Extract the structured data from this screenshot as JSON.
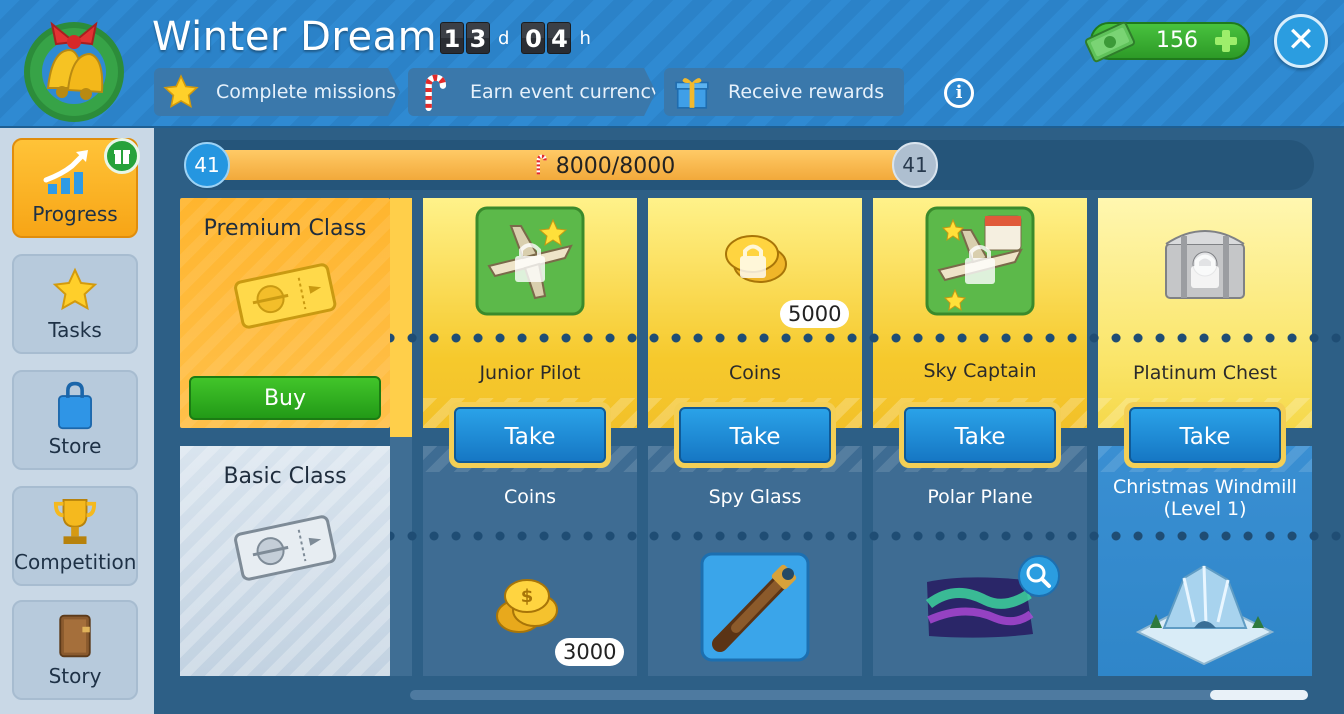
{
  "header": {
    "title": "Winter Dream",
    "timer": {
      "days_digits": [
        "1",
        "3"
      ],
      "days_unit": "d",
      "hours_digits": [
        "0",
        "4"
      ],
      "hours_unit": "h"
    },
    "steps": [
      {
        "label": "Complete missions",
        "icon": "star-icon"
      },
      {
        "label": "Earn event currency",
        "icon": "candy-cane-icon"
      },
      {
        "label": "Receive rewards",
        "icon": "gift-icon"
      }
    ],
    "info_icon": "info-icon",
    "currency": {
      "value": "156",
      "icon": "cash-icon"
    },
    "close_icon": "close-icon"
  },
  "sidebar": {
    "items": [
      {
        "label": "Progress",
        "icon": "progress-chart-icon",
        "active": true,
        "badge_icon": "gift-badge-icon"
      },
      {
        "label": "Tasks",
        "icon": "star-icon",
        "active": false
      },
      {
        "label": "Store",
        "icon": "shopping-bag-icon",
        "active": false
      },
      {
        "label": "Competition",
        "icon": "trophy-icon",
        "active": false
      },
      {
        "label": "Story",
        "icon": "book-icon",
        "active": false
      }
    ]
  },
  "progress": {
    "level_left": "41",
    "level_right": "41",
    "text": "8000/8000",
    "fraction": 1.0,
    "icon": "candy-cane-icon"
  },
  "classes": {
    "premium": {
      "name": "Premium Class",
      "buy_label": "Buy",
      "icon": "gold-ticket-icon"
    },
    "basic": {
      "name": "Basic Class",
      "icon": "silver-ticket-icon"
    }
  },
  "columns": [
    {
      "premium_name": "Junior Pilot",
      "premium_icon": "locked-pilot-badge-icon",
      "premium_qty": "",
      "take_label": "Take",
      "basic_name": "Coins",
      "basic_icon": "coins-icon",
      "basic_qty": "3000"
    },
    {
      "premium_name": "Coins",
      "premium_icon": "locked-coins-icon",
      "premium_qty": "5000",
      "take_label": "Take",
      "basic_name": "Spy Glass",
      "basic_icon": "spyglass-icon",
      "basic_qty": ""
    },
    {
      "premium_name": "Sky Captain",
      "premium_icon": "locked-captain-badge-icon",
      "premium_qty": "",
      "take_label": "Take",
      "basic_name": "Polar Plane",
      "basic_icon": "aurora-plane-icon",
      "basic_qty": ""
    },
    {
      "premium_name": "Platinum Chest",
      "premium_icon": "locked-chest-icon",
      "premium_qty": "",
      "take_label": "Take",
      "basic_name": "Christmas Windmill\n(Level 1)",
      "basic_name_line1": "Christmas Windmill",
      "basic_name_line2": "(Level 1)",
      "basic_icon": "ice-windmill-icon",
      "basic_qty": ""
    }
  ],
  "colors": {
    "header_blue": "#2f8ad2",
    "accent_orange": "#f7a516",
    "take_blue": "#1f8ad6",
    "buy_green": "#2aa81f"
  }
}
